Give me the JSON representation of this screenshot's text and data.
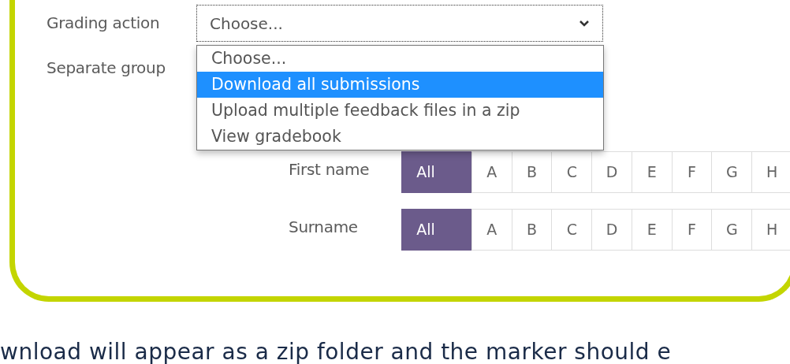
{
  "grading_action": {
    "label": "Grading action",
    "select": {
      "value": "Choose...",
      "expanded": true
    },
    "options": [
      {
        "label": "Choose...",
        "selected": false
      },
      {
        "label": "Download all submissions",
        "selected": true
      },
      {
        "label": "Upload multiple feedback files in a zip",
        "selected": false
      },
      {
        "label": "View gradebook",
        "selected": false
      }
    ]
  },
  "separate_groups": {
    "label": "Separate group"
  },
  "initials_bars": [
    {
      "label": "First name",
      "letters": [
        {
          "label": "All",
          "selected": true
        },
        {
          "label": "A",
          "selected": false
        },
        {
          "label": "B",
          "selected": false
        },
        {
          "label": "C",
          "selected": false
        },
        {
          "label": "D",
          "selected": false
        },
        {
          "label": "E",
          "selected": false
        },
        {
          "label": "F",
          "selected": false
        },
        {
          "label": "G",
          "selected": false
        },
        {
          "label": "H",
          "selected": false
        }
      ]
    },
    {
      "label": "Surname",
      "letters": [
        {
          "label": "All",
          "selected": true
        },
        {
          "label": "A",
          "selected": false
        },
        {
          "label": "B",
          "selected": false
        },
        {
          "label": "C",
          "selected": false
        },
        {
          "label": "D",
          "selected": false
        },
        {
          "label": "E",
          "selected": false
        },
        {
          "label": "F",
          "selected": false
        },
        {
          "label": "G",
          "selected": false
        },
        {
          "label": "H",
          "selected": false
        }
      ]
    }
  ],
  "footer_text": "wnload will appear as a zip folder and the marker should e"
}
